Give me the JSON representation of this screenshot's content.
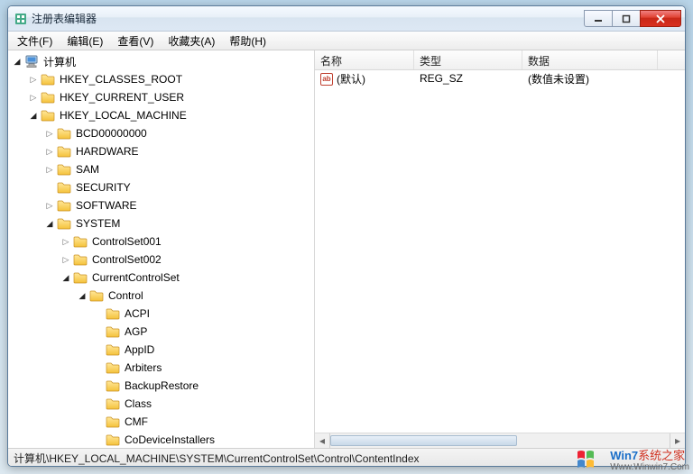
{
  "window": {
    "title": "注册表编辑器"
  },
  "menu": {
    "file": "文件(F)",
    "edit": "编辑(E)",
    "view": "查看(V)",
    "favorites": "收藏夹(A)",
    "help": "帮助(H)"
  },
  "columns": {
    "name": "名称",
    "type": "类型",
    "data": "数据"
  },
  "col_widths": {
    "name": 110,
    "type": 120,
    "data": 150
  },
  "values": [
    {
      "name": "(默认)",
      "type": "REG_SZ",
      "data": "(数值未设置)"
    }
  ],
  "tree": {
    "root": "计算机",
    "items": [
      {
        "label": "HKEY_CLASSES_ROOT",
        "depth": 1,
        "expandable": true,
        "expanded": false
      },
      {
        "label": "HKEY_CURRENT_USER",
        "depth": 1,
        "expandable": true,
        "expanded": false
      },
      {
        "label": "HKEY_LOCAL_MACHINE",
        "depth": 1,
        "expandable": true,
        "expanded": true
      },
      {
        "label": "BCD00000000",
        "depth": 2,
        "expandable": true,
        "expanded": false
      },
      {
        "label": "HARDWARE",
        "depth": 2,
        "expandable": true,
        "expanded": false
      },
      {
        "label": "SAM",
        "depth": 2,
        "expandable": true,
        "expanded": false
      },
      {
        "label": "SECURITY",
        "depth": 2,
        "expandable": false,
        "expanded": false
      },
      {
        "label": "SOFTWARE",
        "depth": 2,
        "expandable": true,
        "expanded": false
      },
      {
        "label": "SYSTEM",
        "depth": 2,
        "expandable": true,
        "expanded": true
      },
      {
        "label": "ControlSet001",
        "depth": 3,
        "expandable": true,
        "expanded": false
      },
      {
        "label": "ControlSet002",
        "depth": 3,
        "expandable": true,
        "expanded": false
      },
      {
        "label": "CurrentControlSet",
        "depth": 3,
        "expandable": true,
        "expanded": true
      },
      {
        "label": "Control",
        "depth": 4,
        "expandable": true,
        "expanded": true
      },
      {
        "label": "ACPI",
        "depth": 5,
        "expandable": false,
        "expanded": false
      },
      {
        "label": "AGP",
        "depth": 5,
        "expandable": false,
        "expanded": false
      },
      {
        "label": "AppID",
        "depth": 5,
        "expandable": false,
        "expanded": false
      },
      {
        "label": "Arbiters",
        "depth": 5,
        "expandable": false,
        "expanded": false
      },
      {
        "label": "BackupRestore",
        "depth": 5,
        "expandable": false,
        "expanded": false
      },
      {
        "label": "Class",
        "depth": 5,
        "expandable": false,
        "expanded": false
      },
      {
        "label": "CMF",
        "depth": 5,
        "expandable": false,
        "expanded": false
      },
      {
        "label": "CoDeviceInstallers",
        "depth": 5,
        "expandable": false,
        "expanded": false
      }
    ]
  },
  "statusbar": "计算机\\HKEY_LOCAL_MACHINE\\SYSTEM\\CurrentControlSet\\Control\\ContentIndex",
  "watermark": {
    "brand1": "Win7",
    "brand2": "系统之家",
    "url": "Www.Winwin7.Com"
  }
}
